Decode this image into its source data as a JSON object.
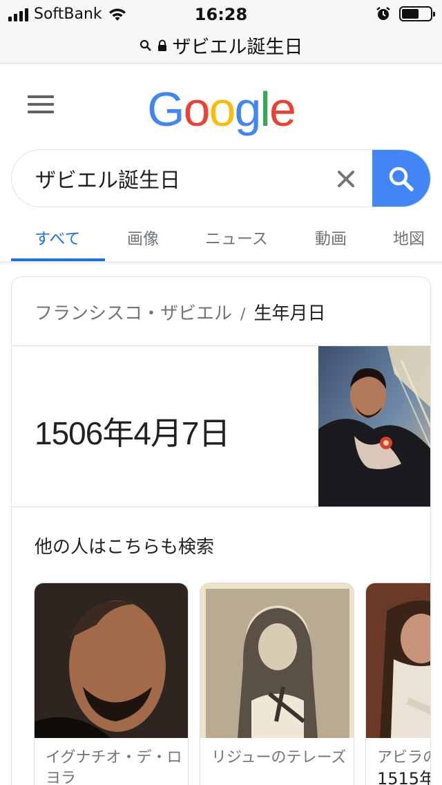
{
  "status_bar": {
    "carrier": "SoftBank",
    "time": "16:28",
    "signal_bars": 4,
    "battery_level": 0.6,
    "icons": [
      "signal-icon",
      "wifi-icon",
      "alarm-icon",
      "battery-icon"
    ]
  },
  "browser": {
    "url_text": "ザビエル誕生日",
    "icons": [
      "search-icon",
      "lock-icon"
    ]
  },
  "header": {
    "logo_letters": [
      {
        "char": "G",
        "color": "#4285f4"
      },
      {
        "char": "o",
        "color": "#ea4335"
      },
      {
        "char": "o",
        "color": "#fbbc05"
      },
      {
        "char": "g",
        "color": "#4285f4"
      },
      {
        "char": "l",
        "color": "#34a853"
      },
      {
        "char": "e",
        "color": "#ea4335"
      }
    ]
  },
  "search": {
    "query": "ザビエル誕生日"
  },
  "tabs": [
    {
      "label": "すべて",
      "active": true
    },
    {
      "label": "画像",
      "active": false
    },
    {
      "label": "ニュース",
      "active": false
    },
    {
      "label": "動画",
      "active": false
    },
    {
      "label": "地図",
      "active": false
    }
  ],
  "knowledge_card": {
    "breadcrumb_entity": "フランシスコ・ザビエル",
    "breadcrumb_separator": "/",
    "breadcrumb_attribute": "生年月日",
    "answer": "1506年4月7日",
    "related_title": "他の人はこちらも検索",
    "related_people": [
      {
        "name": "イグナチオ・デ・ロヨラ",
        "sub": ""
      },
      {
        "name": "リジューのテレーズ",
        "sub": ""
      },
      {
        "name": "アビラの",
        "sub": "1515年"
      }
    ]
  },
  "colors": {
    "accent": "#1a73e8",
    "search_button": "#4285f4",
    "muted_text": "#70757a"
  }
}
